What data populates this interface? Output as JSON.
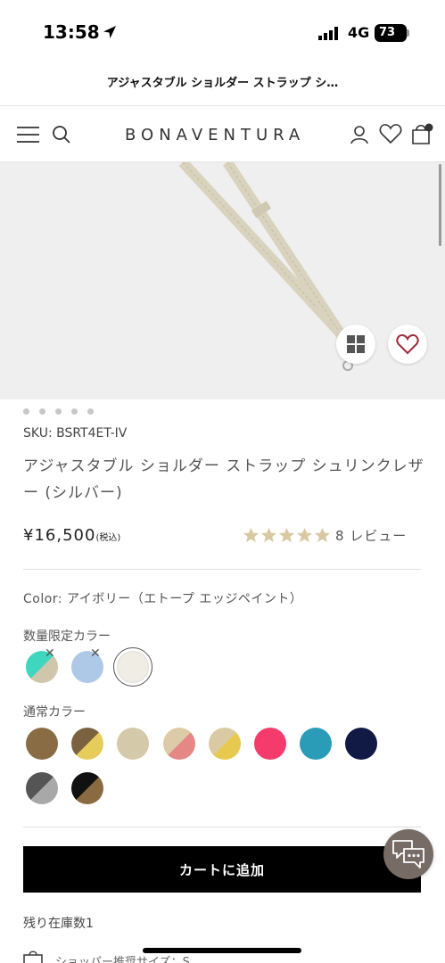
{
  "status": {
    "time": "13:58",
    "network": "4G",
    "battery": "73"
  },
  "page_title": "アジャスタブル ショルダー ストラップ シ…",
  "header": {
    "logo": "BONAVENTURA",
    "icons": [
      "menu-icon",
      "search-icon",
      "account-icon",
      "wishlist-icon",
      "cart-icon"
    ]
  },
  "product": {
    "image_count": 5,
    "sku": "SKU: BSRT4ET-IV",
    "name": "アジャスタブル ショルダー ストラップ シュリンクレザー (シルバー)",
    "price": "¥16,500",
    "tax_note": "(税込)",
    "rating": 5,
    "review_label": "8 レビュー"
  },
  "colors": {
    "current_label": "Color: アイボリー（エトープ エッジペイント）",
    "limited_label": "数量限定カラー",
    "regular_label": "通常カラー",
    "limited": [
      {
        "name": "mint-beige",
        "a": "#3fd6bf",
        "b": "#cfc6ab",
        "sold_out": true
      },
      {
        "name": "light-blue",
        "a": "#aec8e8",
        "b": "#aec8e8",
        "sold_out": true
      },
      {
        "name": "ivory",
        "a": "#efede4",
        "b": "#efede4",
        "sold_out": false,
        "selected": true
      }
    ],
    "regular": [
      {
        "name": "brown",
        "a": "#8a6c44",
        "b": "#8a6c44"
      },
      {
        "name": "brown-yellow",
        "a": "#7a6140",
        "b": "#e6cc5a"
      },
      {
        "name": "greige",
        "a": "#d4c9a9",
        "b": "#d4c9a9"
      },
      {
        "name": "beige-pink",
        "a": "#dccba6",
        "b": "#e58784"
      },
      {
        "name": "beige-yellow",
        "a": "#d9caa3",
        "b": "#e8c94f"
      },
      {
        "name": "pink",
        "a": "#f53b6b",
        "b": "#f53b6b"
      },
      {
        "name": "teal",
        "a": "#2b9cb8",
        "b": "#2b9cb8"
      },
      {
        "name": "navy",
        "a": "#111a45",
        "b": "#111a45"
      },
      {
        "name": "grey",
        "a": "#555555",
        "b": "#a8a8a8"
      },
      {
        "name": "black-brown",
        "a": "#111111",
        "b": "#8a6a40"
      }
    ]
  },
  "cart_button": "カートに追加",
  "stock": "残り在庫数1",
  "shopper": "ショッパー推奨サイズ：S"
}
